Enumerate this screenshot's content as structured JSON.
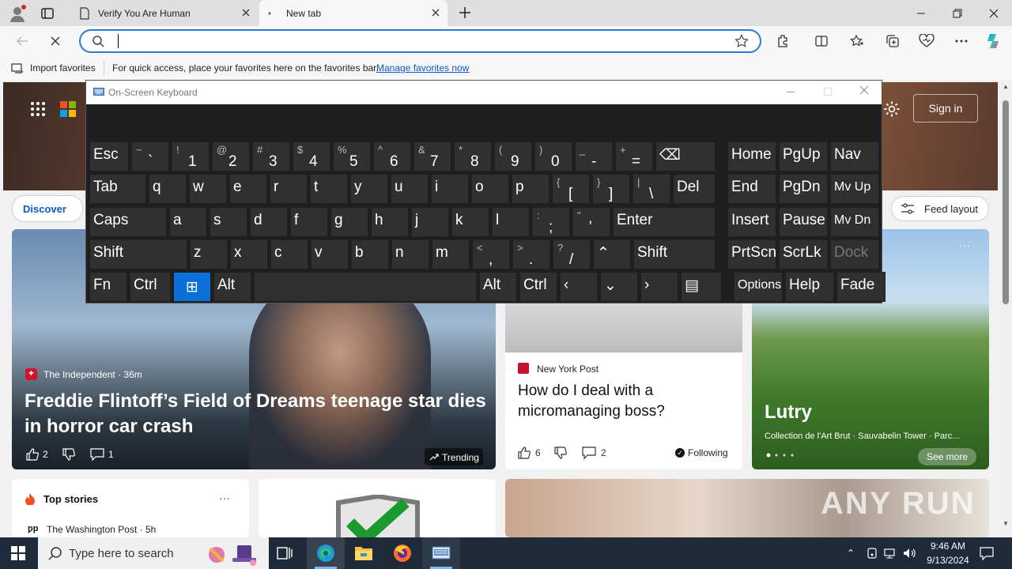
{
  "browser": {
    "tabs": [
      {
        "title": "Verify You Are Human"
      },
      {
        "title": "New tab"
      }
    ],
    "address": {
      "value": "",
      "placeholder": ""
    },
    "favorites_bar": {
      "import_label": "Import favorites",
      "message": "For quick access, place your favorites here on the favorites bar.",
      "manage_link": "Manage favorites now"
    },
    "accent_color": "#2a7ad8"
  },
  "newtab": {
    "sign_in": "Sign in",
    "discover": "Discover",
    "feed_layout": "Feed layout",
    "main_story": {
      "source": "The Independent · 36m",
      "headline": "Freddie Flintoff’s Field of Dreams teenage star dies in horror car crash",
      "likes": "2",
      "comments": "1",
      "badge": "Trending"
    },
    "side_story": {
      "source": "New York Post",
      "headline": "How do I deal with a micromanaging boss?",
      "likes": "6",
      "comments": "2",
      "following": "Following"
    },
    "travel_card": {
      "title": "Lutry",
      "subtitle": "Collection de l'Art Brut · Sauvabelin Tower · Parc...",
      "see_more": "See more"
    },
    "top_stories": {
      "title": "Top stories",
      "item_source": "The Washington Post · 5h"
    }
  },
  "osk": {
    "title": "On-Screen Keyboard",
    "rows": [
      [
        {
          "main": "Esc",
          "w": 50
        },
        {
          "shift": "~",
          "low": "`",
          "w": 48
        },
        {
          "shift": "!",
          "low": "1",
          "w": 48
        },
        {
          "shift": "@",
          "low": "2",
          "w": 48
        },
        {
          "shift": "#",
          "low": "3",
          "w": 48
        },
        {
          "shift": "$",
          "low": "4",
          "w": 48
        },
        {
          "shift": "%",
          "low": "5",
          "w": 48
        },
        {
          "shift": "^",
          "low": "6",
          "w": 48
        },
        {
          "shift": "&",
          "low": "7",
          "w": 48
        },
        {
          "shift": "*",
          "low": "8",
          "w": 48
        },
        {
          "shift": "(",
          "low": "9",
          "w": 48
        },
        {
          "shift": ")",
          "low": "0",
          "w": 48
        },
        {
          "shift": "_",
          "low": "-",
          "w": 48
        },
        {
          "shift": "+",
          "low": "=",
          "w": 48
        },
        {
          "main": "⌫",
          "w": 76
        },
        {
          "gap": 12
        },
        {
          "main": "Home",
          "w": 62
        },
        {
          "main": "PgUp",
          "w": 62
        },
        {
          "main": "Nav",
          "w": 62
        }
      ],
      [
        {
          "main": "Tab",
          "w": 72
        },
        {
          "main": "q",
          "w": 48
        },
        {
          "main": "w",
          "w": 48
        },
        {
          "main": "e",
          "w": 48
        },
        {
          "main": "r",
          "w": 48
        },
        {
          "main": "t",
          "w": 48
        },
        {
          "main": "y",
          "w": 48
        },
        {
          "main": "u",
          "w": 48
        },
        {
          "main": "i",
          "w": 48
        },
        {
          "main": "o",
          "w": 48
        },
        {
          "main": "p",
          "w": 48
        },
        {
          "shift": "{",
          "low": "[",
          "w": 48
        },
        {
          "shift": "}",
          "low": "]",
          "w": 48
        },
        {
          "shift": "|",
          "low": "\\",
          "w": 48
        },
        {
          "main": "Del",
          "w": 54
        },
        {
          "gap": 12
        },
        {
          "main": "End",
          "w": 62
        },
        {
          "main": "PgDn",
          "w": 62
        },
        {
          "main": "Mv Up",
          "w": 62,
          "small": true
        }
      ],
      [
        {
          "main": "Caps",
          "w": 98
        },
        {
          "main": "a",
          "w": 48
        },
        {
          "main": "s",
          "w": 48
        },
        {
          "main": "d",
          "w": 48
        },
        {
          "main": "f",
          "w": 48
        },
        {
          "main": "g",
          "w": 48
        },
        {
          "main": "h",
          "w": 48
        },
        {
          "main": "j",
          "w": 48
        },
        {
          "main": "k",
          "w": 48
        },
        {
          "main": "l",
          "w": 48
        },
        {
          "shift": ":",
          "low": ";",
          "w": 48
        },
        {
          "shift": "\"",
          "low": "'",
          "w": 48
        },
        {
          "main": "Enter",
          "w": 130
        },
        {
          "gap": 12
        },
        {
          "main": "Insert",
          "w": 62
        },
        {
          "main": "Pause",
          "w": 62
        },
        {
          "main": "Mv Dn",
          "w": 62,
          "small": true
        }
      ],
      [
        {
          "main": "Shift",
          "w": 124
        },
        {
          "main": "z",
          "w": 48
        },
        {
          "main": "x",
          "w": 48
        },
        {
          "main": "c",
          "w": 48
        },
        {
          "main": "v",
          "w": 48
        },
        {
          "main": "b",
          "w": 48
        },
        {
          "main": "n",
          "w": 48
        },
        {
          "main": "m",
          "w": 48
        },
        {
          "shift": "<",
          "low": ",",
          "w": 48
        },
        {
          "shift": ">",
          "low": ".",
          "w": 48
        },
        {
          "shift": "?",
          "low": "/",
          "w": 48
        },
        {
          "main": "⌃",
          "w": 48
        },
        {
          "main": "Shift",
          "w": 104
        },
        {
          "gap": 12
        },
        {
          "main": "PrtScn",
          "w": 62
        },
        {
          "main": "ScrLk",
          "w": 62
        },
        {
          "main": "Dock",
          "w": 62,
          "dim": true
        }
      ],
      [
        {
          "main": "Fn",
          "w": 48
        },
        {
          "main": "Ctrl",
          "w": 52
        },
        {
          "main": "⊞",
          "w": 48,
          "active": true
        },
        {
          "main": "Alt",
          "w": 48
        },
        {
          "main": "",
          "w": 282
        },
        {
          "main": "Alt",
          "w": 48
        },
        {
          "main": "Ctrl",
          "w": 48
        },
        {
          "main": "‹",
          "w": 48
        },
        {
          "main": "⌄",
          "w": 48
        },
        {
          "main": "›",
          "w": 48
        },
        {
          "main": "▤",
          "w": 52
        },
        {
          "gap": 12
        },
        {
          "main": "Options",
          "w": 62,
          "small": true
        },
        {
          "main": "Help",
          "w": 62
        },
        {
          "main": "Fade",
          "w": 62
        }
      ]
    ]
  },
  "taskbar": {
    "search_placeholder": "Type here to search",
    "time": "9:46 AM",
    "date": "9/13/2024"
  },
  "watermark": "ANY RUN"
}
